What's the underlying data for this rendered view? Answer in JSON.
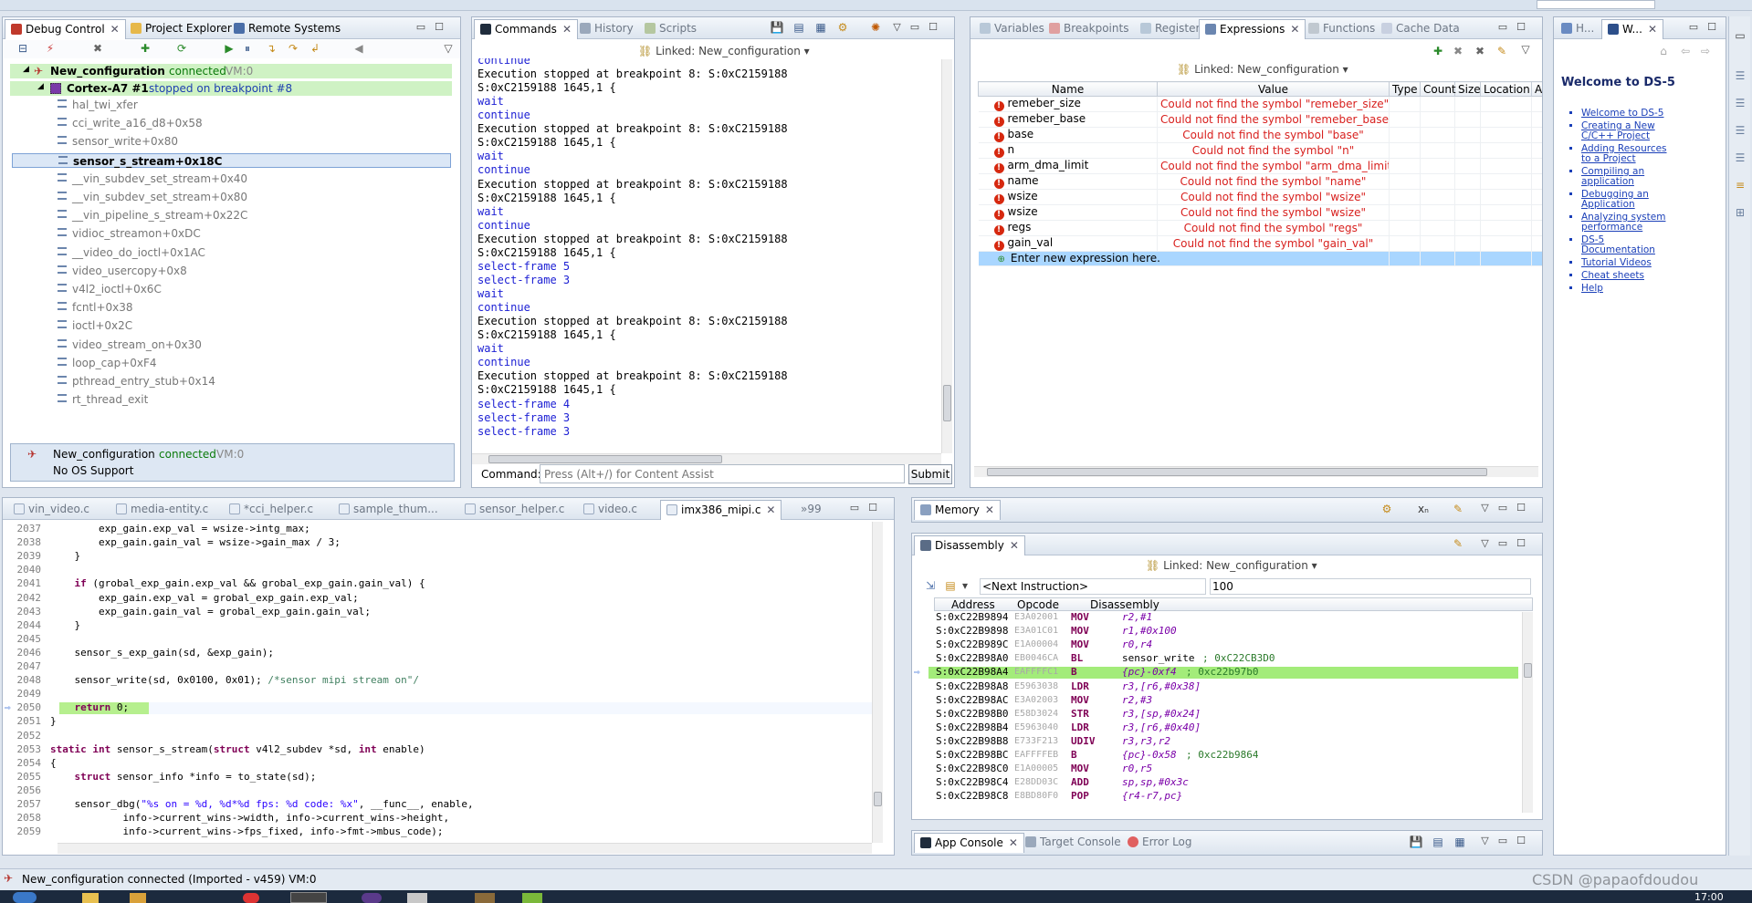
{
  "colors": {
    "accent": "#1a3fb8",
    "connected": "#0a7a0a",
    "error": "#d8201e",
    "highlight": "#a3ec7a",
    "selection": "#a9d6ff"
  },
  "debug_control": {
    "tabs": [
      "Debug Control",
      "Project Explorer",
      "Remote Systems"
    ],
    "config_name": "New_configuration",
    "config_status": "connected",
    "config_vm": "VM:0",
    "core_name": "Cortex-A7 #1",
    "core_status": "stopped on breakpoint #8",
    "stack": [
      "hal_twi_xfer",
      "cci_write_a16_d8+0x58",
      "sensor_write+0x80",
      "sensor_s_stream+0x18C",
      "__vin_subdev_set_stream+0x40",
      "__vin_subdev_set_stream+0x80",
      "__vin_pipeline_s_stream+0x22C",
      "vidioc_streamon+0xDC",
      "__video_do_ioctl+0x1AC",
      "video_usercopy+0x8",
      "v4l2_ioctl+0x6C",
      "fcntl+0x38",
      "ioctl+0x2C",
      "video_stream_on+0x30",
      "loop_cap+0xF4",
      "pthread_entry_stub+0x14",
      "rt_thread_exit"
    ],
    "info_config": "New_configuration",
    "info_status": "connected",
    "info_vm": "VM:0",
    "info_os": "No OS Support"
  },
  "commands": {
    "tabs": [
      "Commands",
      "History",
      "Scripts"
    ],
    "linked": "Linked: New_configuration",
    "lines": [
      {
        "t": "continue",
        "c": "blue"
      },
      {
        "t": "Execution stopped at breakpoint 8: S:0xC2159188",
        "c": "black"
      },
      {
        "t": "S:0xC2159188   1645,1   {",
        "c": "black"
      },
      {
        "t": "wait",
        "c": "blue"
      },
      {
        "t": "continue",
        "c": "blue"
      },
      {
        "t": "Execution stopped at breakpoint 8: S:0xC2159188",
        "c": "black"
      },
      {
        "t": "S:0xC2159188   1645,1   {",
        "c": "black"
      },
      {
        "t": "wait",
        "c": "blue"
      },
      {
        "t": "continue",
        "c": "blue"
      },
      {
        "t": "Execution stopped at breakpoint 8: S:0xC2159188",
        "c": "black"
      },
      {
        "t": "S:0xC2159188   1645,1   {",
        "c": "black"
      },
      {
        "t": "wait",
        "c": "blue"
      },
      {
        "t": "continue",
        "c": "blue"
      },
      {
        "t": "Execution stopped at breakpoint 8: S:0xC2159188",
        "c": "black"
      },
      {
        "t": "S:0xC2159188   1645,1   {",
        "c": "black"
      },
      {
        "t": "select-frame 5",
        "c": "blue"
      },
      {
        "t": "select-frame 3",
        "c": "blue"
      },
      {
        "t": "wait",
        "c": "blue"
      },
      {
        "t": "continue",
        "c": "blue"
      },
      {
        "t": "Execution stopped at breakpoint 8: S:0xC2159188",
        "c": "black"
      },
      {
        "t": "S:0xC2159188   1645,1   {",
        "c": "black"
      },
      {
        "t": "wait",
        "c": "blue"
      },
      {
        "t": "continue",
        "c": "blue"
      },
      {
        "t": "Execution stopped at breakpoint 8: S:0xC2159188",
        "c": "black"
      },
      {
        "t": "S:0xC2159188   1645,1   {",
        "c": "black"
      },
      {
        "t": "select-frame 4",
        "c": "blue"
      },
      {
        "t": "select-frame 3",
        "c": "blue"
      },
      {
        "t": "select-frame 3",
        "c": "blue"
      }
    ],
    "command_label": "Command:",
    "command_placeholder": "Press (Alt+/) for Content Assist",
    "submit": "Submit"
  },
  "expressions": {
    "tabs": [
      "Variables",
      "Breakpoints",
      "Registers",
      "Expressions",
      "Functions",
      "Cache Data"
    ],
    "linked": "Linked: New_configuration",
    "columns": [
      "Name",
      "Value",
      "Type",
      "Count",
      "Size",
      "Location",
      "A"
    ],
    "rows": [
      {
        "name": "remeber_size",
        "value": "Could not find the symbol \"remeber_size\""
      },
      {
        "name": "remeber_base",
        "value": "Could not find the symbol \"remeber_base\""
      },
      {
        "name": "base",
        "value": "Could not find the symbol \"base\""
      },
      {
        "name": "n",
        "value": "Could not find the symbol \"n\""
      },
      {
        "name": "arm_dma_limit",
        "value": "Could not find the symbol \"arm_dma_limit\""
      },
      {
        "name": "name",
        "value": "Could not find the symbol \"name\""
      },
      {
        "name": "wsize",
        "value": "Could not find the symbol \"wsize\""
      },
      {
        "name": "wsize",
        "value": "Could not find the symbol \"wsize\""
      },
      {
        "name": "regs",
        "value": "Could not find the symbol \"regs\""
      },
      {
        "name": "gain_val",
        "value": "Could not find the symbol \"gain_val\""
      }
    ],
    "new_expr": "Enter new expression here."
  },
  "welcome": {
    "tabs": [
      "H...",
      "W..."
    ],
    "title": "Welcome to DS-5",
    "links": [
      "Welcome to DS-5",
      "Creating a New C/C++ Project",
      "Adding Resources to a Project",
      "Compiling an application",
      "Debugging an Application",
      "Analyzing system performance",
      "DS-5 Documentation",
      "Tutorial Videos",
      "Cheat sheets",
      "Help"
    ]
  },
  "editor": {
    "tabs": [
      "vin_video.c",
      "media-entity.c",
      "*cci_helper.c",
      "sample_thum...",
      "sensor_helper.c",
      "video.c",
      "imx386_mipi.c",
      "»99"
    ],
    "lines": [
      {
        "n": "2037",
        "code": "        exp_gain.exp_val = wsize->intg_max;"
      },
      {
        "n": "2038",
        "code": "        exp_gain.gain_val = wsize->gain_max / 3;"
      },
      {
        "n": "2039",
        "code": "    }"
      },
      {
        "n": "2040",
        "code": ""
      },
      {
        "n": "2041",
        "code": "    if (grobal_exp_gain.exp_val && grobal_exp_gain.gain_val) {"
      },
      {
        "n": "2042",
        "code": "        exp_gain.exp_val = grobal_exp_gain.exp_val;"
      },
      {
        "n": "2043",
        "code": "        exp_gain.gain_val = grobal_exp_gain.gain_val;"
      },
      {
        "n": "2044",
        "code": "    }"
      },
      {
        "n": "2045",
        "code": ""
      },
      {
        "n": "2046",
        "code": "    sensor_s_exp_gain(sd, &exp_gain);"
      },
      {
        "n": "2047",
        "code": ""
      },
      {
        "n": "2048",
        "code": "    sensor_write(sd, 0x0100, 0x01); /*sensor mipi stream on\"/"
      },
      {
        "n": "2049",
        "code": ""
      },
      {
        "n": "2050",
        "code": "    return 0;"
      },
      {
        "n": "2051",
        "code": "}"
      },
      {
        "n": "2052",
        "code": ""
      },
      {
        "n": "2053",
        "code": "static int sensor_s_stream(struct v4l2_subdev *sd, int enable)"
      },
      {
        "n": "2054",
        "code": "{"
      },
      {
        "n": "2055",
        "code": "    struct sensor_info *info = to_state(sd);"
      },
      {
        "n": "2056",
        "code": ""
      },
      {
        "n": "2057",
        "code": "    sensor_dbg(\"%s on = %d, %d*%d fps: %d code: %x\", __func__, enable,"
      },
      {
        "n": "2058",
        "code": "            info->current_wins->width, info->current_wins->height,"
      },
      {
        "n": "2059",
        "code": "            info->current_wins->fps_fixed, info->fmt->mbus_code);"
      }
    ]
  },
  "memory": {
    "tab": "Memory"
  },
  "disassembly": {
    "tab": "Disassembly",
    "linked": "Linked: New_configuration",
    "next_instruction": "<Next Instruction>",
    "count": "100",
    "columns": [
      "Address",
      "Opcode",
      "Disassembly"
    ],
    "rows": [
      {
        "addr": "S:0xC22B9894",
        "op": "E3A02001",
        "mn": "MOV",
        "args": "r2,#1",
        "cmt": ""
      },
      {
        "addr": "S:0xC22B9898",
        "op": "E3A01C01",
        "mn": "MOV",
        "args": "r1,#0x100",
        "cmt": ""
      },
      {
        "addr": "S:0xC22B989C",
        "op": "E1A00004",
        "mn": "MOV",
        "args": "r0,r4",
        "cmt": ""
      },
      {
        "addr": "S:0xC22B98A0",
        "op": "EB0046CA",
        "mn": "BL",
        "args": "sensor_write",
        "cmt": " ; 0xC22CB3D0"
      },
      {
        "addr": "S:0xC22B98A4",
        "op": "EAFFFFC1",
        "mn": "B",
        "args": "{pc}-0xf4",
        "cmt": " ; 0xc22b97b0"
      },
      {
        "addr": "S:0xC22B98A8",
        "op": "E5963038",
        "mn": "LDR",
        "args": "r3,[r6,#0x38]",
        "cmt": ""
      },
      {
        "addr": "S:0xC22B98AC",
        "op": "E3A02003",
        "mn": "MOV",
        "args": "r2,#3",
        "cmt": ""
      },
      {
        "addr": "S:0xC22B98B0",
        "op": "E58D3024",
        "mn": "STR",
        "args": "r3,[sp,#0x24]",
        "cmt": ""
      },
      {
        "addr": "S:0xC22B98B4",
        "op": "E5963040",
        "mn": "LDR",
        "args": "r3,[r6,#0x40]",
        "cmt": ""
      },
      {
        "addr": "S:0xC22B98B8",
        "op": "E733F213",
        "mn": "UDIV",
        "args": "r3,r3,r2",
        "cmt": ""
      },
      {
        "addr": "S:0xC22B98BC",
        "op": "EAFFFFEB",
        "mn": "B",
        "args": "{pc}-0x58",
        "cmt": " ; 0xc22b9864"
      },
      {
        "addr": "S:0xC22B98C0",
        "op": "E1A00005",
        "mn": "MOV",
        "args": "r0,r5",
        "cmt": ""
      },
      {
        "addr": "S:0xC22B98C4",
        "op": "E28DD03C",
        "mn": "ADD",
        "args": "sp,sp,#0x3c",
        "cmt": ""
      },
      {
        "addr": "S:0xC22B98C8",
        "op": "E8BD80F0",
        "mn": "POP",
        "args": "{r4-r7,pc}",
        "cmt": ""
      }
    ]
  },
  "console": {
    "tabs": [
      "App Console",
      "Target Console",
      "Error Log"
    ]
  },
  "status": {
    "text": "New_configuration connected (Imported - v459) VM:0",
    "watermark": "CSDN @papaofdoudou",
    "clock": "17:00"
  }
}
